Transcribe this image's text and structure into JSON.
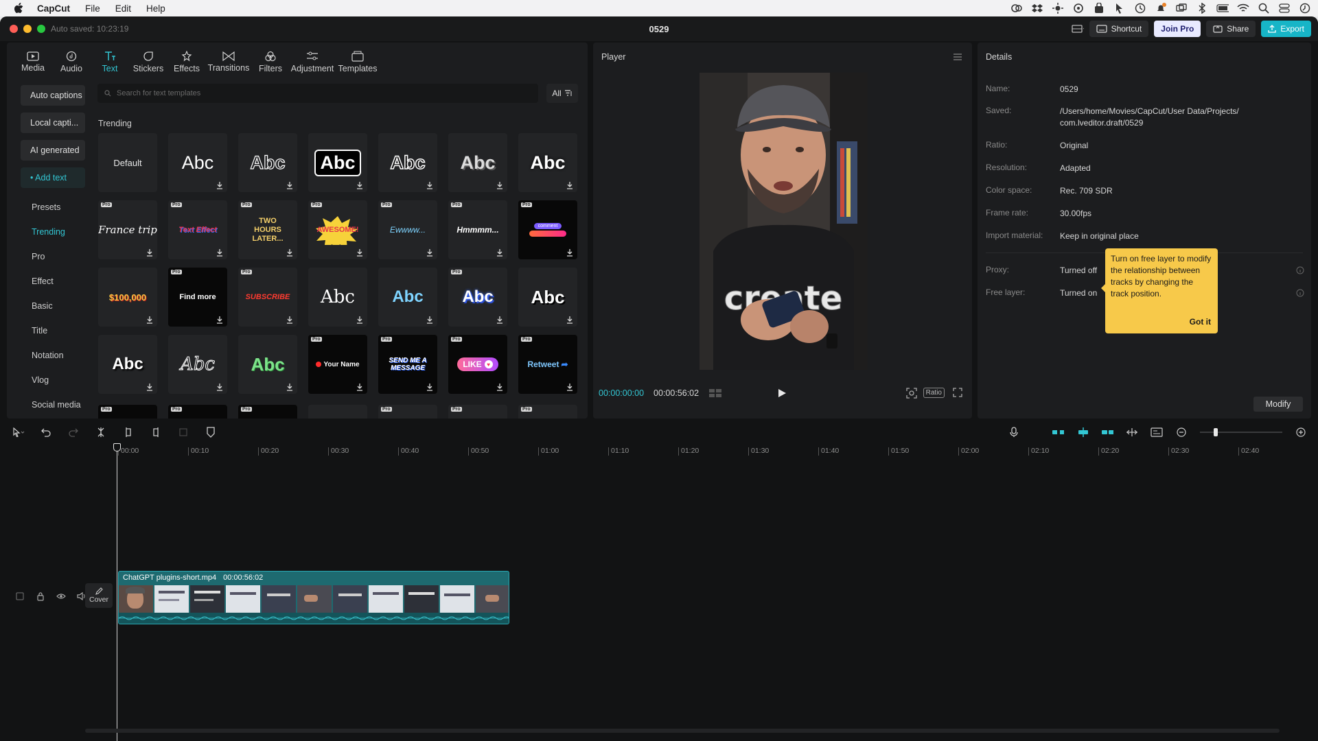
{
  "menubar": {
    "app": "CapCut",
    "items": [
      "File",
      "Edit",
      "Help"
    ]
  },
  "window": {
    "autosave": "Auto saved: 10:23:19",
    "title": "0529",
    "buttons": {
      "shortcut": "Shortcut",
      "join_pro": "Join Pro",
      "share": "Share",
      "export": "Export"
    }
  },
  "toptabs": [
    {
      "label": "Media",
      "icon": "media-icon"
    },
    {
      "label": "Audio",
      "icon": "audio-icon"
    },
    {
      "label": "Text",
      "icon": "text-icon"
    },
    {
      "label": "Stickers",
      "icon": "stickers-icon"
    },
    {
      "label": "Effects",
      "icon": "effects-icon"
    },
    {
      "label": "Transitions",
      "icon": "transitions-icon"
    },
    {
      "label": "Filters",
      "icon": "filters-icon"
    },
    {
      "label": "Adjustment",
      "icon": "adjustment-icon"
    },
    {
      "label": "Templates",
      "icon": "templates-icon"
    }
  ],
  "sidenav": {
    "buttons": [
      "Auto captions",
      "Local capti...",
      "AI generated",
      "• Add text"
    ],
    "items": [
      "Presets",
      "Trending",
      "Pro",
      "Effect",
      "Basic",
      "Title",
      "Notation",
      "Vlog",
      "Social media"
    ]
  },
  "search": {
    "placeholder": "Search for text templates",
    "filter": "All"
  },
  "section_title": "Trending",
  "tiles": [
    "Default",
    "Abc",
    "Abc",
    "Abc",
    "Abc",
    "Abc",
    "Abc",
    "France trip",
    "Text Effect",
    "TWO HOURS LATER...",
    "AWESOME!",
    "Ewwww...",
    "Hmmmm...",
    "comment",
    "$100,000",
    "Find more",
    "SUBSCRIBE",
    "Abc",
    "Abc",
    "Abc",
    "Abc",
    "Abc",
    "Abc",
    "Abc",
    "Your Name",
    "SEND ME A MESSAGE",
    "LIKE",
    "Retweet"
  ],
  "player": {
    "title": "Player",
    "current": "00:00:00:00",
    "duration": "00:00:56:02",
    "ratio": "Ratio",
    "video_text": "create"
  },
  "details": {
    "title": "Details",
    "rows": [
      {
        "k": "Name:",
        "v": "0529"
      },
      {
        "k": "Saved:",
        "v": "/Users/home/Movies/CapCut/User Data/Projects/",
        "v2": "com.lveditor.draft/0529"
      },
      {
        "k": "Ratio:",
        "v": "Original"
      },
      {
        "k": "Resolution:",
        "v": "Adapted"
      },
      {
        "k": "Color space:",
        "v": "Rec. 709 SDR"
      },
      {
        "k": "Frame rate:",
        "v": "30.00fps"
      },
      {
        "k": "Import material:",
        "v": "Keep in original place"
      },
      {
        "k": "Proxy:",
        "v": "Turned off"
      },
      {
        "k": "Free layer:",
        "v": "Turned on"
      }
    ],
    "tooltip": "Turn on free layer to modify the relationship between tracks by changing the track position.",
    "tooltip_btn": "Got it",
    "modify": "Modify"
  },
  "ruler": [
    "00:00",
    "00:10",
    "00:20",
    "00:30",
    "00:40",
    "00:50",
    "01:00",
    "01:10",
    "01:20",
    "01:30",
    "01:40",
    "01:50",
    "02:00",
    "02:10",
    "02:20",
    "02:30",
    "02:40"
  ],
  "clip": {
    "name": "ChatGPT plugins-short.mp4",
    "duration": "00:00:56:02"
  },
  "cover": "Cover"
}
